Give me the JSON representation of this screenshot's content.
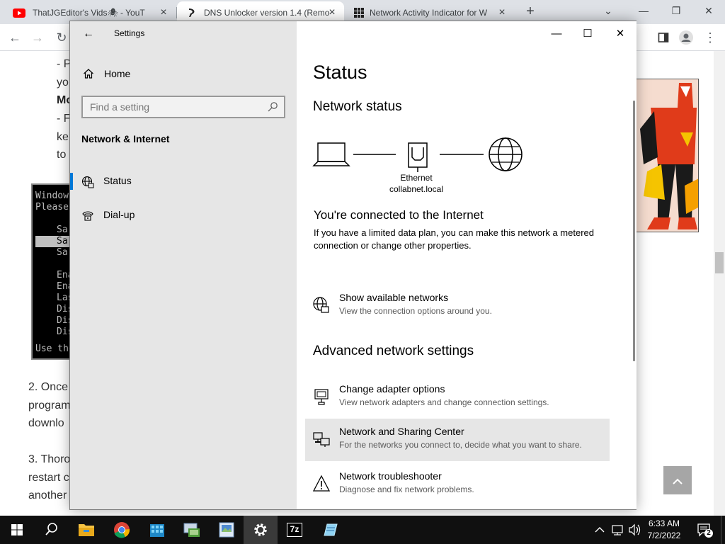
{
  "browser": {
    "tabs": [
      {
        "title": "ThatJGEditor's Vids🕷 - YouT"
      },
      {
        "title": "DNS Unlocker version 1.4 (Remo"
      },
      {
        "title": "Network Activity Indicator for W"
      }
    ],
    "newtab_label": "+"
  },
  "webpage": {
    "lines": [
      {
        "text": "- P"
      },
      {
        "text": "yo"
      },
      {
        "text": "Mo"
      },
      {
        "text": "- F"
      },
      {
        "text": "ke"
      },
      {
        "text": "to"
      },
      {
        "text": "2. Once"
      },
      {
        "text": "program"
      },
      {
        "text": "downlo"
      },
      {
        "text": "3. Thoro"
      },
      {
        "text": "restart c"
      },
      {
        "text": "another"
      }
    ],
    "terminal_lines": [
      "Windows",
      "Please",
      "Sa",
      "Sa",
      "Sa",
      "Ena",
      "Ena",
      "Las",
      "Dis",
      "Dis",
      "Dis",
      "Use the"
    ]
  },
  "settings": {
    "window_title": "Settings",
    "home_label": "Home",
    "search_placeholder": "Find a setting",
    "section_label": "Network & Internet",
    "nav_items": [
      {
        "label": "Status",
        "icon": "globe-icon",
        "selected": true
      },
      {
        "label": "Dial-up",
        "icon": "dialup-icon",
        "selected": false
      }
    ],
    "accent_color": "#0078d7",
    "page_title": "Status",
    "network_status_heading": "Network status",
    "adapter_name": "Ethernet",
    "network_name": "collabnet.local",
    "connected_heading": "You're connected to the Internet",
    "connected_body": "If you have a limited data plan, you can make this network a metered connection or change other properties.",
    "show_networks": {
      "title": "Show available networks",
      "subtitle": "View the connection options around you."
    },
    "advanced_heading": "Advanced network settings",
    "links": [
      {
        "title": "Change adapter options",
        "subtitle": "View network adapters and change connection settings.",
        "icon": "monitor-network-icon"
      },
      {
        "title": "Network and Sharing Center",
        "subtitle": "For the networks you connect to, decide what you want to share.",
        "icon": "sharing-center-icon"
      },
      {
        "title": "Network troubleshooter",
        "subtitle": "Diagnose and fix network problems.",
        "icon": "warning-icon"
      }
    ]
  },
  "taskbar": {
    "time": "6:33 AM",
    "date": "7/2/2022",
    "notification_count": "2",
    "apps": [
      "start-icon",
      "search-icon",
      "file-explorer-icon",
      "chrome-icon",
      "app-icon-blocks",
      "network-app-icon",
      "image-app-icon",
      "settings-icon",
      "7zip-icon",
      "notepad-icon"
    ],
    "sevenzip_label": "7z"
  }
}
